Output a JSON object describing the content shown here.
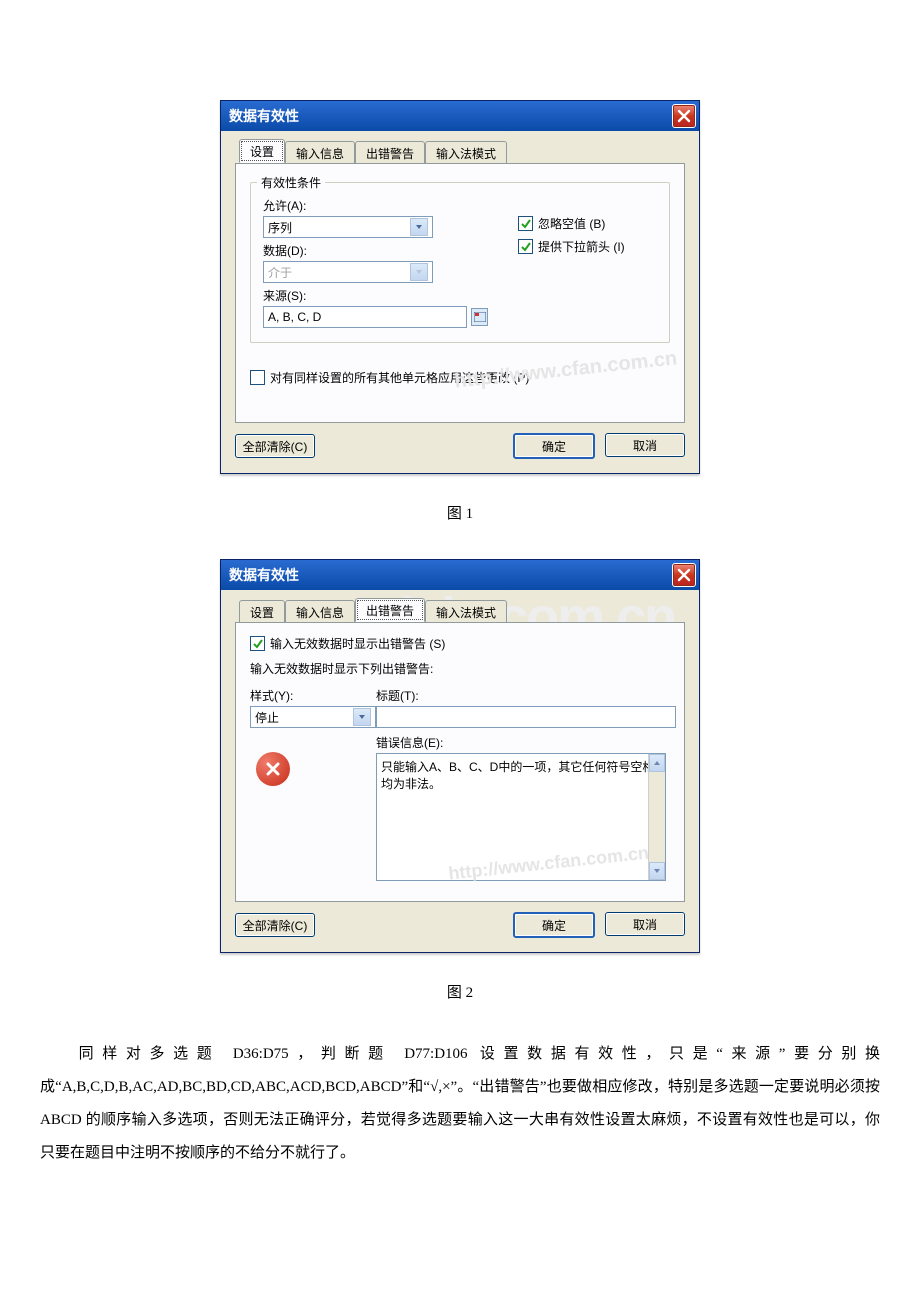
{
  "dialog1": {
    "title": "数据有效性",
    "tabs": {
      "settings": "设置",
      "input": "输入信息",
      "error": "出错警告",
      "ime": "输入法模式"
    },
    "group_title": "有效性条件",
    "allow_label": "允许(A):",
    "allow_value": "序列",
    "data_label": "数据(D):",
    "data_value": "介于",
    "source_label": "来源(S):",
    "source_value": "A, B, C, D",
    "ignore_blank": "忽略空值 (B)",
    "dropdown_arrow": "提供下拉箭头 (I)",
    "apply_others": "对有同样设置的所有其他单元格应用这些更改 (P)",
    "watermark": "http://www.cfan.com.cn",
    "clear_all": "全部清除(C)",
    "ok": "确定",
    "cancel": "取消"
  },
  "caption1": "图 1",
  "dialog2": {
    "title": "数据有效性",
    "tabs": {
      "settings": "设置",
      "input": "输入信息",
      "error": "出错警告",
      "ime": "输入法模式"
    },
    "show_alert": "输入无效数据时显示出错警告 (S)",
    "group_title": "输入无效数据时显示下列出错警告:",
    "style_label": "样式(Y):",
    "style_value": "停止",
    "title_label": "标题(T):",
    "title_value": "",
    "message_label": "错误信息(E):",
    "message_value": "只能输入A、B、C、D中的一项，其它任何符号空格均为非法。",
    "watermark": "http://www.cfan.com.cn",
    "wm_big": "www.yixin.com.cn",
    "clear_all": "全部清除(C)",
    "ok": "确定",
    "cancel": "取消"
  },
  "caption2": "图 2",
  "paragraph": "同样对多选题 D36:D75，判断题 D77:D106 设置数据有效性，只是“来源”要分别换成“A,B,C,D,B,AC,AD,BC,BD,CD,ABC,ACD,BCD,ABCD”和“√,×”。“出错警告”也要做相应修改，特别是多选题一定要说明必须按 ABCD 的顺序输入多选项，否则无法正确评分，若觉得多选题要输入这一大串有效性设置太麻烦，不设置有效性也是可以，你只要在题目中注明不按顺序的不给分不就行了。"
}
